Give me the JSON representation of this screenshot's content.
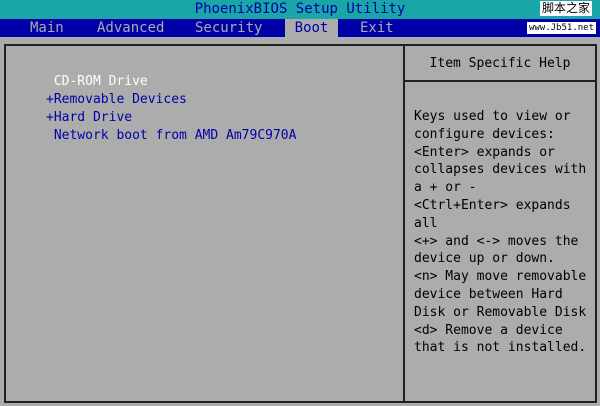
{
  "title": "PhoenixBIOS Setup Utility",
  "tabs": [
    "Main",
    "Advanced",
    "Security",
    "Boot",
    "Exit"
  ],
  "active_tab": "Boot",
  "watermark": {
    "site_name": "脚本之家",
    "url": "www.Jb51.net"
  },
  "boot_items": [
    " CD-ROM Drive",
    "+Removable Devices",
    "+Hard Drive",
    " Network boot from AMD Am79C970A"
  ],
  "help_title": "Item Specific Help",
  "help_text": "Keys used to view or\nconfigure devices:\n<Enter> expands or\ncollapses devices with\na + or -\n<Ctrl+Enter> expands\nall\n<+> and <-> moves the\ndevice up or down.\n<n> May move removable\ndevice between Hard\nDisk or Removable Disk\n<d> Remove a device\nthat is not installed."
}
